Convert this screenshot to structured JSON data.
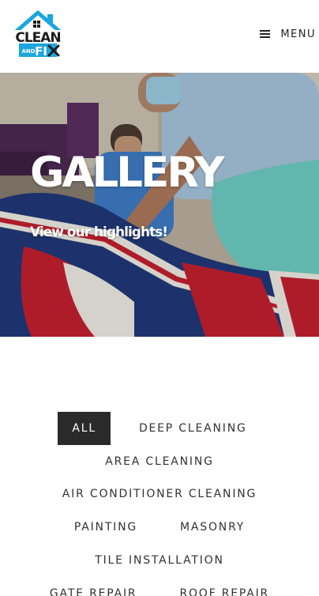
{
  "header": {
    "logo": {
      "line1": "CLEAN",
      "line2": "AND FIX"
    },
    "menu_label": "MENU",
    "menu_icon": "hamburger-icon"
  },
  "hero": {
    "title": "GALLERY",
    "subtitle": "View our highlights!"
  },
  "filters": {
    "items": [
      {
        "label": "ALL",
        "active": true
      },
      {
        "label": "DEEP CLEANING",
        "active": false
      },
      {
        "label": "AREA CLEANING",
        "active": false
      },
      {
        "label": "AIR CONDITIONER CLEANING",
        "active": false
      },
      {
        "label": "PAINTING",
        "active": false
      },
      {
        "label": "MASONRY",
        "active": false
      },
      {
        "label": "TILE INSTALLATION",
        "active": false
      },
      {
        "label": "GATE REPAIR",
        "active": false
      },
      {
        "label": "ROOF REPAIR",
        "active": false
      }
    ]
  },
  "colors": {
    "brand_blue": "#1aa6de",
    "brand_dark": "#1b1b1b",
    "active_filter_bg": "#2a2a2a"
  }
}
